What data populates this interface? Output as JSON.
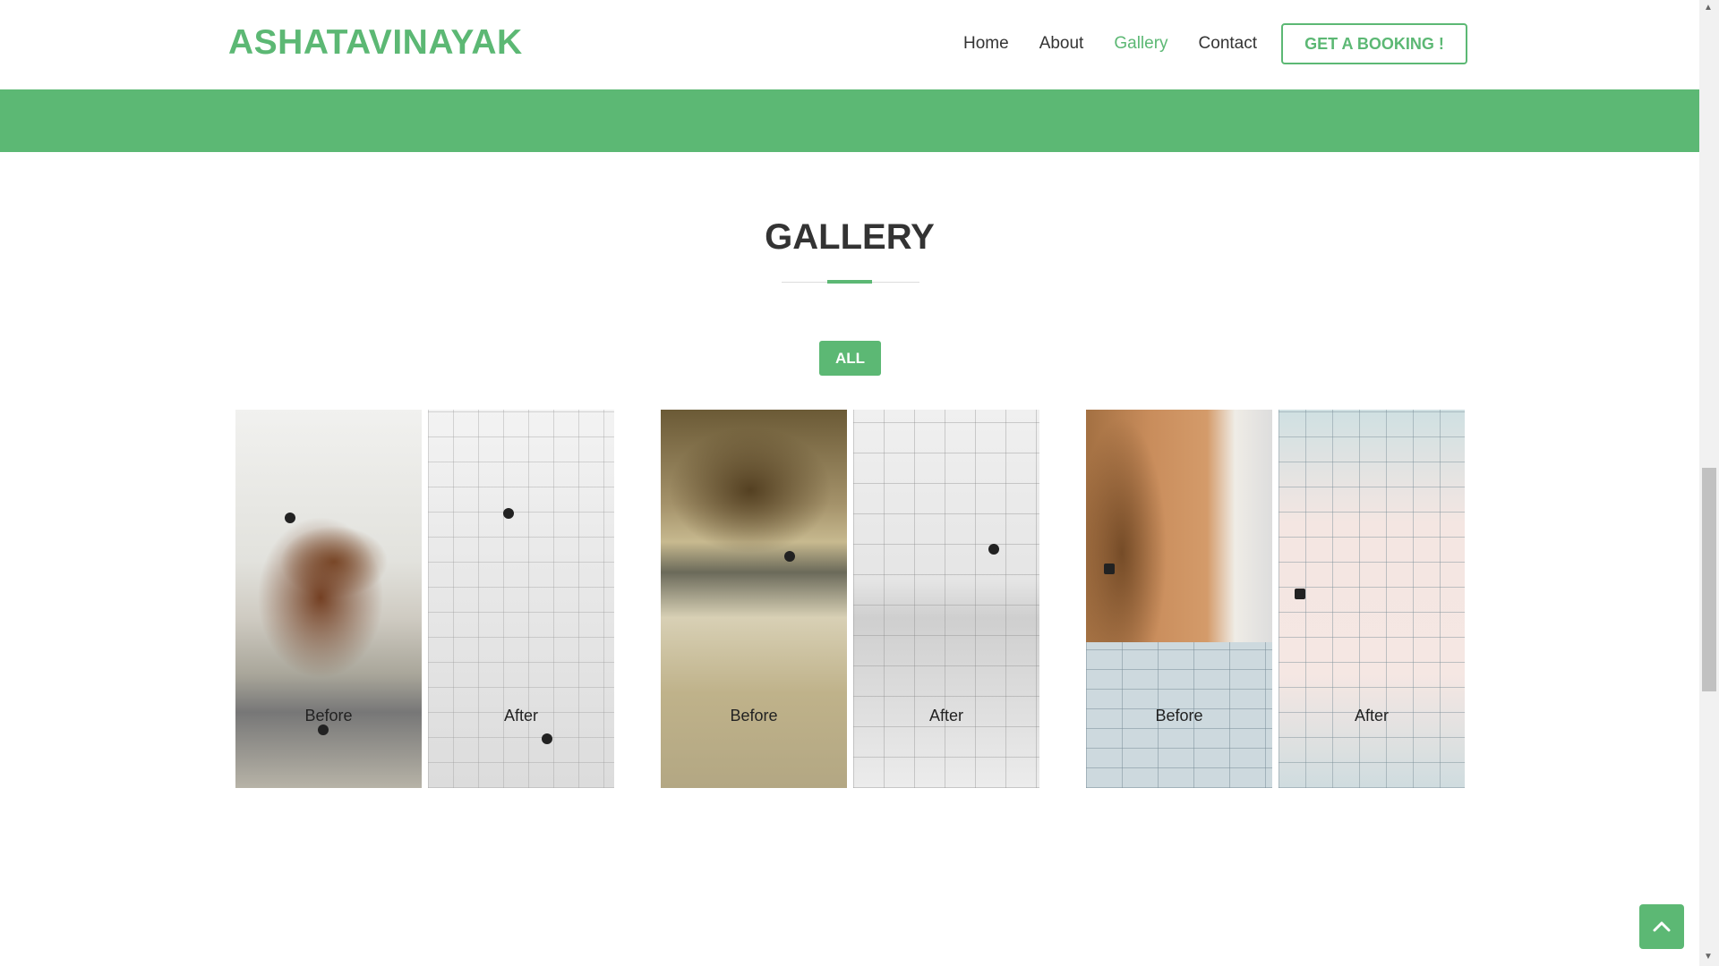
{
  "header": {
    "logo": "ASHATAVINAYAK",
    "nav": [
      {
        "label": "Home",
        "active": false
      },
      {
        "label": "About",
        "active": false
      },
      {
        "label": "Gallery",
        "active": true
      },
      {
        "label": "Contact",
        "active": false
      }
    ],
    "booking_label": "GET A BOOKING !"
  },
  "gallery": {
    "title": "GALLERY",
    "filter_label": "ALL",
    "items": [
      {
        "before_label": "Before",
        "after_label": "After"
      },
      {
        "before_label": "Before",
        "after_label": "After"
      },
      {
        "before_label": "Before",
        "after_label": "After"
      }
    ]
  },
  "colors": {
    "accent": "#5cb874",
    "text": "#333333"
  },
  "icons": {
    "scroll_top": "chevron-up-icon"
  }
}
